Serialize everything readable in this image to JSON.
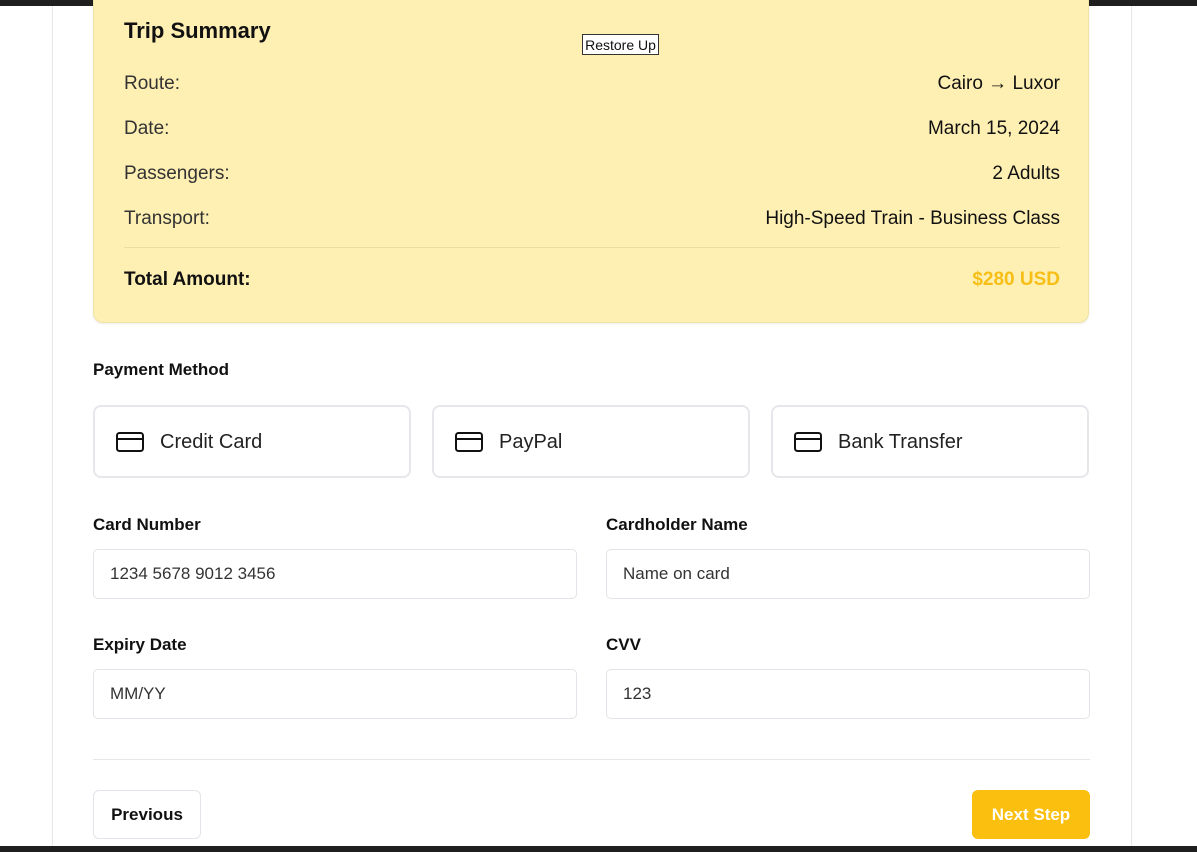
{
  "summary": {
    "title": "Trip Summary",
    "rows": [
      {
        "label": "Route:",
        "value": "Cairo → Luxor"
      },
      {
        "label": "Date:",
        "value": "March 15, 2024"
      },
      {
        "label": "Passengers:",
        "value": "2 Adults"
      },
      {
        "label": "Transport:",
        "value": "High-Speed Train - Business Class"
      }
    ],
    "total_label": "Total Amount:",
    "total_value": "$280 USD"
  },
  "tooltip": {
    "text": "Restore Up"
  },
  "payment": {
    "section_label": "Payment Method",
    "methods": [
      {
        "label": "Credit Card",
        "icon": "credit-card-icon"
      },
      {
        "label": "PayPal",
        "icon": "credit-card-icon"
      },
      {
        "label": "Bank Transfer",
        "icon": "credit-card-icon"
      }
    ]
  },
  "form": {
    "card_number": {
      "label": "Card Number",
      "value": "",
      "placeholder": "1234 5678 9012 3456"
    },
    "cardholder": {
      "label": "Cardholder Name",
      "value": "",
      "placeholder": "Name on card"
    },
    "expiry": {
      "label": "Expiry Date",
      "value": "",
      "placeholder": "MM/YY"
    },
    "cvv": {
      "label": "CVV",
      "value": "",
      "placeholder": "123"
    }
  },
  "nav": {
    "previous_label": "Previous",
    "next_label": "Next Step"
  },
  "colors": {
    "summary_bg": "#feefb3",
    "accent": "#fbbf0f",
    "total_text": "#f7bf16"
  }
}
